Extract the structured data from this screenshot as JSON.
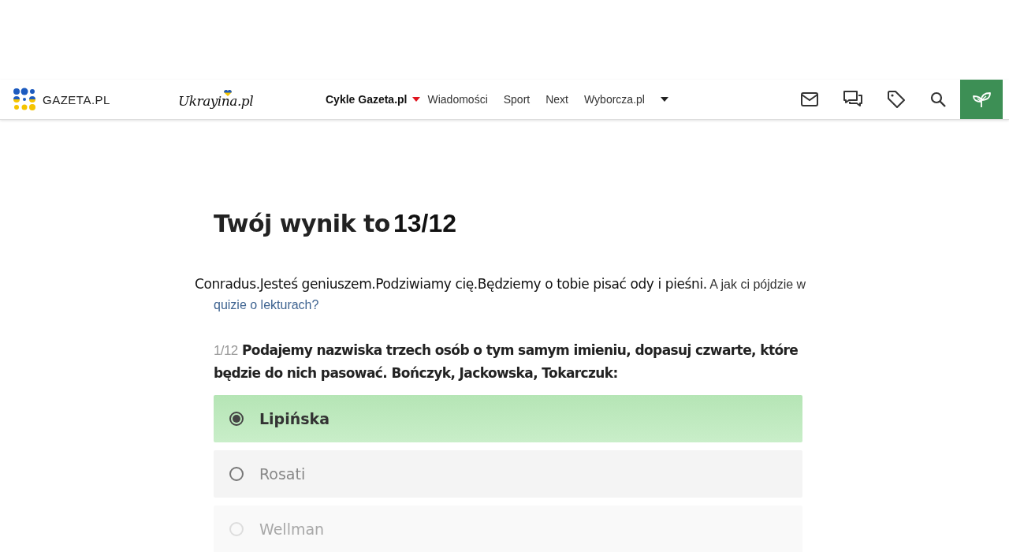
{
  "header": {
    "logo": "GAZETA.PL",
    "partner_logo": "Ukrayina.pl",
    "nav": [
      {
        "label": "Cykle Gazeta.pl",
        "kind": "highlight",
        "dropdown": true
      },
      {
        "label": "Wiadomości",
        "kind": "plain",
        "dropdown": false
      },
      {
        "label": "Sport",
        "kind": "plain",
        "dropdown": false
      },
      {
        "label": "Next",
        "kind": "plain",
        "dropdown": false
      },
      {
        "label": "Wyborcza.pl",
        "kind": "plain",
        "dropdown": true
      }
    ]
  },
  "result": {
    "heading": "Twój wynik to",
    "score": "13/12",
    "message": "Conradus.Jesteś geniuszem.Podziwiamy cię.Będziemy o tobie pisać ody i pieśni.",
    "followup": "A jak ci pójdzie w",
    "link": "quizie o lekturach?"
  },
  "question": {
    "number": "1/12",
    "text": "Podajemy nazwiska trzech osób o tym samym imieniu, dopasuj czwarte, które będzie do nich pasować. Bończyk, Jackowska, Tokarczuk:",
    "options": [
      {
        "label": "Lipińska",
        "selected": true,
        "faded": false
      },
      {
        "label": "Rosati",
        "selected": false,
        "faded": false
      },
      {
        "label": "Wellman",
        "selected": false,
        "faded": true
      }
    ]
  }
}
